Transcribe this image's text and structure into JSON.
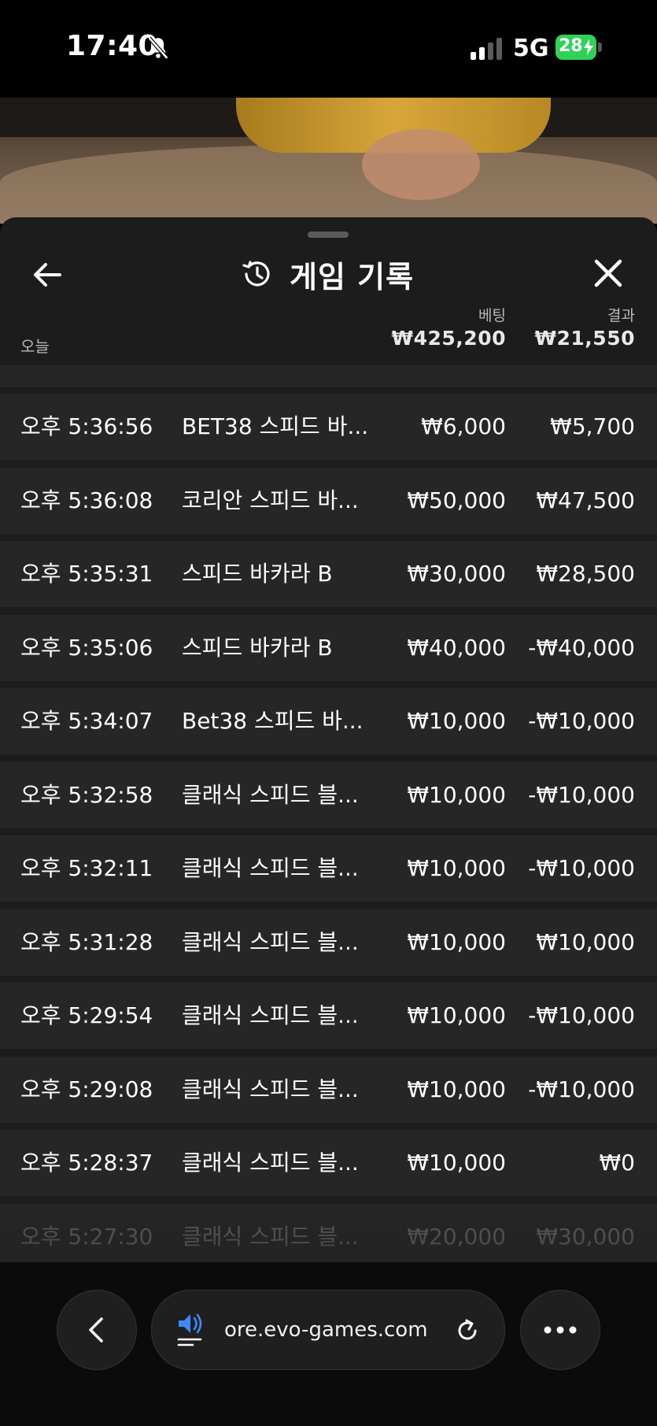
{
  "status_bar": {
    "time": "17:40",
    "network": "5G",
    "battery": "28"
  },
  "sheet": {
    "title": "게임 기록",
    "today_label": "오늘",
    "bet_label": "베팅",
    "bet_total": "₩425,200",
    "result_label": "결과",
    "result_total": "₩21,550"
  },
  "records": [
    {
      "time": "오후 5:36:56",
      "game": "BET38 스피드 바...",
      "bet": "₩6,000",
      "result": "₩5,700"
    },
    {
      "time": "오후 5:36:08",
      "game": "코리안 스피드 바...",
      "bet": "₩50,000",
      "result": "₩47,500"
    },
    {
      "time": "오후 5:35:31",
      "game": "스피드 바카라 B",
      "bet": "₩30,000",
      "result": "₩28,500"
    },
    {
      "time": "오후 5:35:06",
      "game": "스피드 바카라 B",
      "bet": "₩40,000",
      "result": "-₩40,000"
    },
    {
      "time": "오후 5:34:07",
      "game": "Bet38 스피드 바...",
      "bet": "₩10,000",
      "result": "-₩10,000"
    },
    {
      "time": "오후 5:32:58",
      "game": "클래식 스피드 블...",
      "bet": "₩10,000",
      "result": "-₩10,000"
    },
    {
      "time": "오후 5:32:11",
      "game": "클래식 스피드 블...",
      "bet": "₩10,000",
      "result": "-₩10,000"
    },
    {
      "time": "오후 5:31:28",
      "game": "클래식 스피드 블...",
      "bet": "₩10,000",
      "result": "₩10,000"
    },
    {
      "time": "오후 5:29:54",
      "game": "클래식 스피드 블...",
      "bet": "₩10,000",
      "result": "-₩10,000"
    },
    {
      "time": "오후 5:29:08",
      "game": "클래식 스피드 블...",
      "bet": "₩10,000",
      "result": "-₩10,000"
    },
    {
      "time": "오후 5:28:37",
      "game": "클래식 스피드 블...",
      "bet": "₩10,000",
      "result": "₩0"
    },
    {
      "time": "오후 5:27:30",
      "game": "클래식 스피드 블...",
      "bet": "₩20,000",
      "result": "₩30,000"
    }
  ],
  "browser": {
    "url": "ore.evo-games.com"
  },
  "icons": {
    "status": [
      "bell-slash-icon",
      "signal-icon",
      "battery-icon",
      "bolt-icon"
    ],
    "sheet": [
      "arrow-left-icon",
      "history-icon",
      "close-icon"
    ],
    "browser": [
      "chevron-left-icon",
      "sound-icon",
      "reload-icon",
      "more-icon"
    ]
  },
  "colors": {
    "sheet_background": "#1c1c1c",
    "row_background": "#262626",
    "battery": "#30d158",
    "sound_icon": "#3d8bff"
  }
}
